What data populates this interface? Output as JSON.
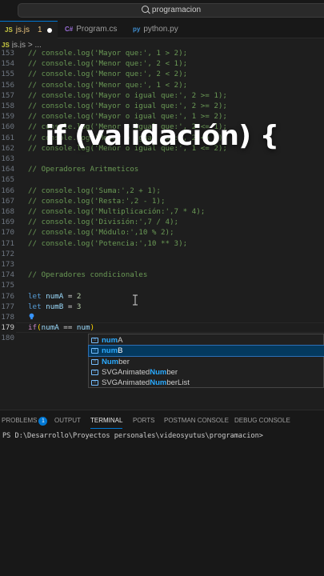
{
  "search": {
    "text": "programacion"
  },
  "tabs": [
    {
      "icon": "JS",
      "label": "js.js",
      "count": "1"
    },
    {
      "icon": "C#",
      "label": "Program.cs"
    },
    {
      "icon": "py",
      "label": "python.py"
    }
  ],
  "breadcrumb": {
    "icon": "JS",
    "file": "js.js",
    "sep": ">",
    "ellipsis": "..."
  },
  "overlay_title": "if (validación) {",
  "editor_lines": [
    {
      "n": "153",
      "t": "// console.log('Mayor que:', 1 > 2);"
    },
    {
      "n": "154",
      "t": "// console.log('Menor que:', 2 < 1);"
    },
    {
      "n": "155",
      "t": "// console.log('Menor que:', 2 < 2);"
    },
    {
      "n": "156",
      "t": "// console.log('Menor que:', 1 < 2);"
    },
    {
      "n": "157",
      "t": "// console.log('Mayor o igual que:', 2 >= 1);"
    },
    {
      "n": "158",
      "t": "// console.log('Mayor o igual que:', 2 >= 2);"
    },
    {
      "n": "159",
      "t": "// console.log('Mayor o igual que:', 1 >= 2);"
    },
    {
      "n": "160",
      "t": "// console.log('Menor o igual que:', 2 <= 1);"
    },
    {
      "n": "161",
      "t": "// console.log('Menor o igual que:', 2 <= 2);"
    },
    {
      "n": "162",
      "t": "// console.log('Menor o igual que:', 1 <= 2);"
    },
    {
      "n": "163",
      "t": ""
    },
    {
      "n": "164",
      "t": "// Operadores Aritmeticos"
    },
    {
      "n": "165",
      "t": ""
    },
    {
      "n": "166",
      "t": "// console.log('Suma:',2 + 1);"
    },
    {
      "n": "167",
      "t": "// console.log('Resta:',2 - 1);"
    },
    {
      "n": "168",
      "t": "// console.log('Multiplicación:',7 * 4);"
    },
    {
      "n": "169",
      "t": "// console.log('División:',7 / 4);"
    },
    {
      "n": "170",
      "t": "// console.log('Módulo:',10 % 2);"
    },
    {
      "n": "171",
      "t": "// console.log('Potencia:',10 ** 3);"
    },
    {
      "n": "172",
      "t": ""
    },
    {
      "n": "173",
      "t": ""
    },
    {
      "n": "174",
      "t": "// Operadores condicionales"
    },
    {
      "n": "175",
      "t": ""
    },
    {
      "n": "176",
      "t": "let numA = 2"
    },
    {
      "n": "177",
      "t": "let numB = 3"
    },
    {
      "n": "178",
      "t": ""
    },
    {
      "n": "179",
      "t": "if(numA == num)"
    },
    {
      "n": "180",
      "t": ""
    }
  ],
  "current_line": "179",
  "suggestions": [
    {
      "pre": "",
      "match": "num",
      "post": "A",
      "selected": false,
      "kind": "variable"
    },
    {
      "pre": "",
      "match": "num",
      "post": "B",
      "selected": true,
      "kind": "variable"
    },
    {
      "pre": "",
      "match": "Num",
      "post": "ber",
      "selected": false,
      "kind": "variable"
    },
    {
      "pre": "SVGAnimated",
      "match": "Num",
      "post": "ber",
      "selected": false,
      "kind": "variable"
    },
    {
      "pre": "SVGAnimated",
      "match": "Num",
      "post": "berList",
      "selected": false,
      "kind": "variable"
    }
  ],
  "panel": {
    "tabs": [
      {
        "label": "PROBLEMS",
        "badge": "1"
      },
      {
        "label": "OUTPUT"
      },
      {
        "label": "TERMINAL",
        "active": true
      },
      {
        "label": "PORTS"
      },
      {
        "label": "POSTMAN CONSOLE"
      },
      {
        "label": "DEBUG CONSOLE"
      }
    ],
    "prompt": "PS D:\\Desarrollo\\Proyectos personales\\videosyutus\\programacion>"
  },
  "colors": {
    "comment": "#6a9955",
    "keyword": "#569cd6",
    "variable": "#9cdcfe",
    "number": "#b5cea8",
    "control": "#c586c0",
    "accent": "#0078d4"
  }
}
